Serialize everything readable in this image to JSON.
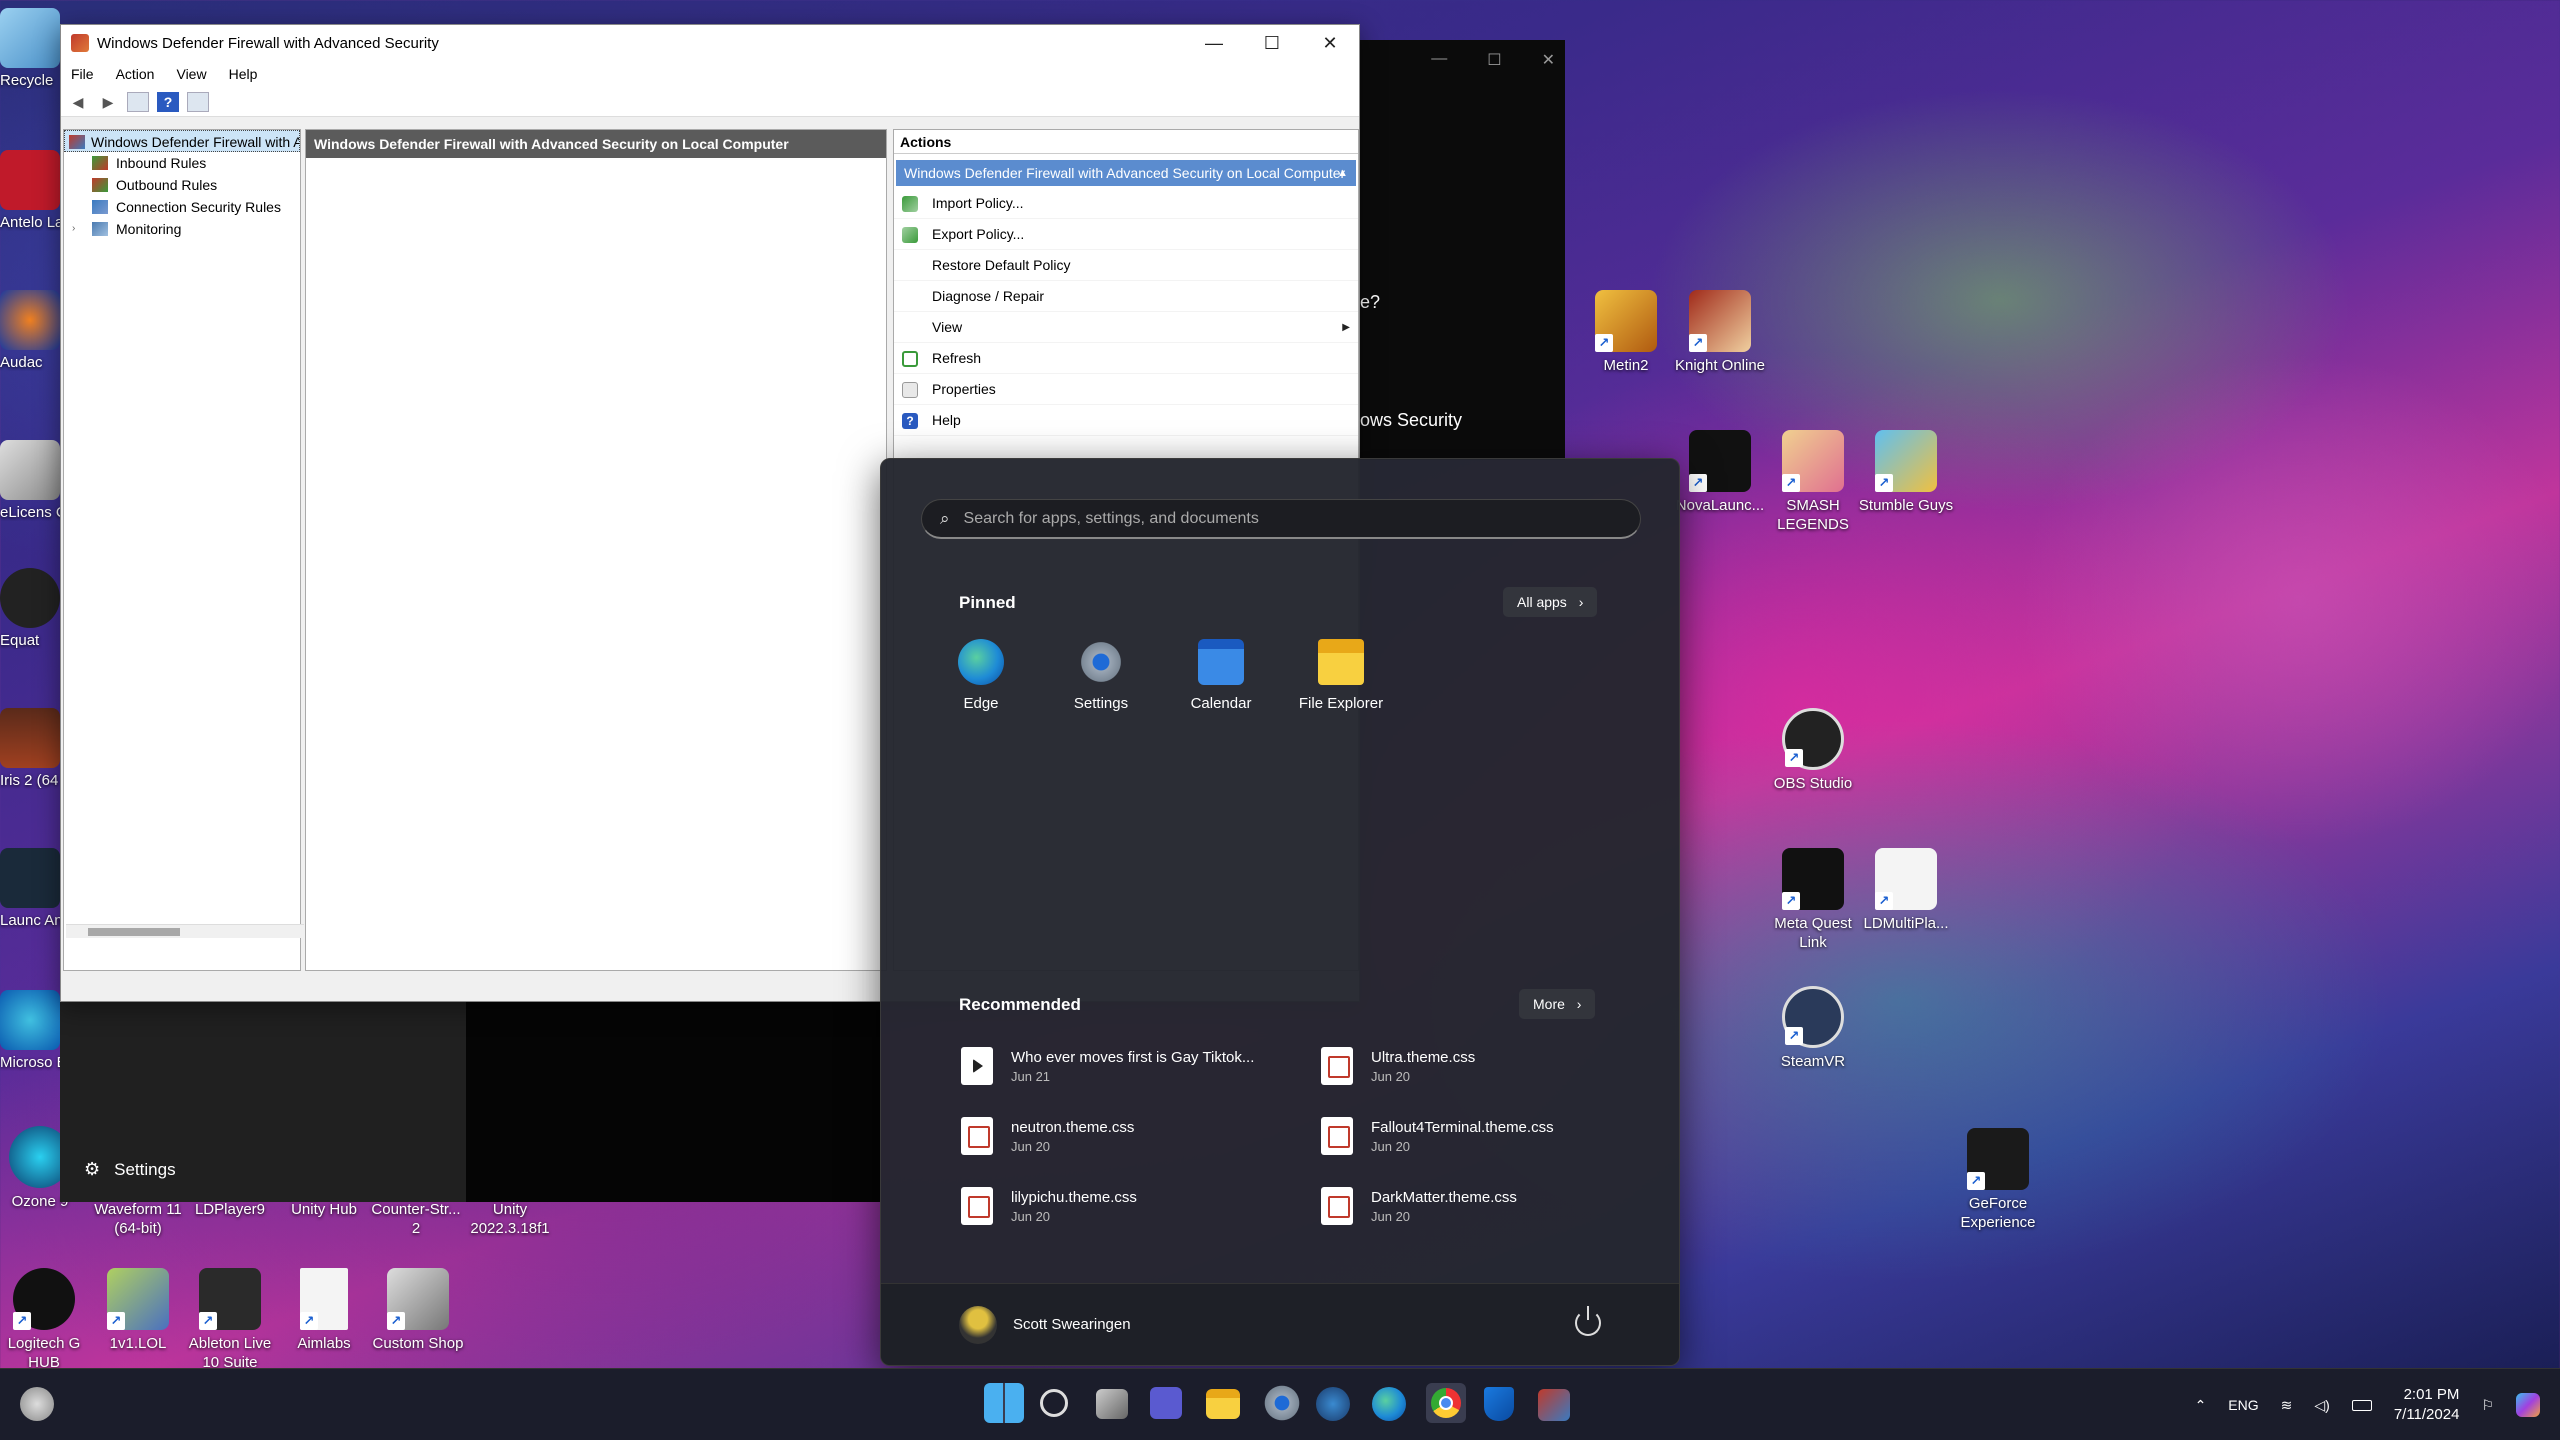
{
  "firewall": {
    "title": "Windows Defender Firewall with Advanced Security",
    "menu": [
      "File",
      "Action",
      "View",
      "Help"
    ],
    "tree": {
      "root": "Windows Defender Firewall with Advanced Security",
      "items": [
        "Inbound Rules",
        "Outbound Rules",
        "Connection Security Rules",
        "Monitoring"
      ]
    },
    "center_header": "Windows Defender Firewall with Advanced Security on Local Computer",
    "actions": {
      "header": "Actions",
      "section": "Windows Defender Firewall with Advanced Security on Local Computer",
      "items": [
        "Import Policy...",
        "Export Policy...",
        "Restore Default Policy",
        "Diagnose / Repair",
        "View",
        "Refresh",
        "Properties",
        "Help"
      ]
    }
  },
  "background_windows": {
    "settings_label": "Settings",
    "dark_text_1": "e?",
    "dark_text_2": "ows Security"
  },
  "start_menu": {
    "search_placeholder": "Search for apps, settings, and documents",
    "pinned_title": "Pinned",
    "all_apps_label": "All apps",
    "pinned": [
      {
        "name": "Edge",
        "icon": "edge-icon",
        "color": "#1e8bd6"
      },
      {
        "name": "Settings",
        "icon": "gear-icon",
        "color": "#7b8896"
      },
      {
        "name": "Calendar",
        "icon": "calendar-icon",
        "color": "#2b7ad6"
      },
      {
        "name": "File Explorer",
        "icon": "folder-icon",
        "color": "#f0c020"
      }
    ],
    "recommended_title": "Recommended",
    "more_label": "More",
    "recommended": [
      {
        "name": "Who ever moves first is Gay Tiktok...",
        "date": "Jun 21",
        "kind": "video"
      },
      {
        "name": "Ultra.theme.css",
        "date": "Jun 20",
        "kind": "css"
      },
      {
        "name": "neutron.theme.css",
        "date": "Jun 20",
        "kind": "css"
      },
      {
        "name": "Fallout4Terminal.theme.css",
        "date": "Jun 20",
        "kind": "css"
      },
      {
        "name": "lilypichu.theme.css",
        "date": "Jun 20",
        "kind": "css"
      },
      {
        "name": "DarkMatter.theme.css",
        "date": "Jun 20",
        "kind": "css"
      }
    ],
    "user_name": "Scott Swearingen"
  },
  "desktop": {
    "left_column": [
      "Recycle",
      "Antelo Launc",
      "Audac",
      "eLicens Contro",
      "Equat",
      "Iris 2 (64",
      "Launc Antares",
      "Microso Edge"
    ],
    "bottom_row_1": [
      "Ozone 9",
      "Waveform 11 (64-bit)",
      "LDPlayer9",
      "Unity Hub",
      "Counter-Str... 2",
      "Unity 2022.3.18f1"
    ],
    "bottom_row_2": [
      "Logitech G HUB",
      "1v1.LOL",
      "Ableton Live 10 Suite",
      "Aimlabs",
      "Custom Shop"
    ],
    "right_icons": [
      "Metin2",
      "Knight Online",
      "NovaLaunc...",
      "SMASH LEGENDS",
      "Stumble Guys",
      "OBS Studio",
      "Meta Quest Link",
      "LDMultiPla...",
      "SteamVR",
      "GeForce Experience"
    ]
  },
  "taskbar": {
    "apps": [
      "start-icon",
      "search-icon",
      "task-view-icon",
      "teams-icon",
      "file-explorer-icon",
      "settings-icon",
      "steam-icon",
      "edge-icon",
      "chrome-icon",
      "defender-icon",
      "firewall-icon"
    ],
    "language": "ENG",
    "time": "2:01 PM",
    "date": "7/11/2024"
  }
}
